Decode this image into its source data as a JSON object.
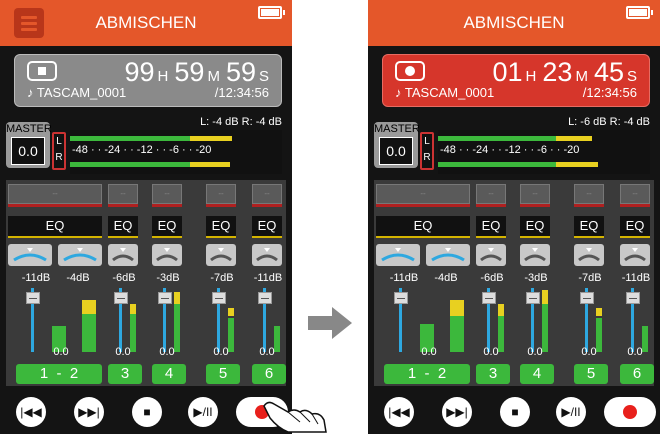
{
  "panels": [
    {
      "state": "stopped",
      "title": "ABMISCHEN",
      "counter": {
        "h": "99",
        "m": "59",
        "s": "59",
        "h_unit": "H",
        "m_unit": "M",
        "s_unit": "S",
        "file": "♪ TASCAM_0001",
        "total": "/12:34:56"
      },
      "master": {
        "label": "MASTER",
        "value": "0.0"
      },
      "meter": {
        "levels_text": "L:  -4 dB  R:  -4 dB",
        "scale": "-48 · · -24 · · -12 · · -6 · · -20",
        "lr": [
          "L",
          "R"
        ]
      },
      "channels": [
        {
          "gain": "-11dB",
          "gain2": "-4dB",
          "value": "0.0",
          "label": "1  -  2"
        },
        {
          "gain": "-6dB",
          "value": "0.0",
          "label": "3"
        },
        {
          "gain": "-3dB",
          "value": "0.0",
          "label": "4"
        },
        {
          "gain": "-7dB",
          "value": "0.0",
          "label": "5"
        },
        {
          "gain": "-11dB",
          "value": "0.0",
          "label": "6"
        }
      ],
      "eq_label": "EQ",
      "slot_text": "--"
    },
    {
      "state": "recording",
      "title": "ABMISCHEN",
      "counter": {
        "h": "01",
        "m": "23",
        "s": "45",
        "h_unit": "H",
        "m_unit": "M",
        "s_unit": "S",
        "file": "♪ TASCAM_0001",
        "total": "/12:34:56"
      },
      "master": {
        "label": "MASTER",
        "value": "0.0"
      },
      "meter": {
        "levels_text": "L:  -6 dB  R:  -4 dB",
        "scale": "-48 · · -24 · · -12 · · -6 · · -20",
        "lr": [
          "L",
          "R"
        ]
      },
      "channels": [
        {
          "gain": "-11dB",
          "gain2": "-4dB",
          "value": "0.0",
          "label": "1  -  2"
        },
        {
          "gain": "-6dB",
          "value": "0.0",
          "label": "3"
        },
        {
          "gain": "-3dB",
          "value": "0.0",
          "label": "4"
        },
        {
          "gain": "-7dB",
          "value": "0.0",
          "label": "5"
        },
        {
          "gain": "-11dB",
          "value": "0.0",
          "label": "6"
        }
      ],
      "eq_label": "EQ",
      "slot_text": "--"
    }
  ],
  "transport": {
    "rewind": "|◀◀",
    "forward": "▶▶|",
    "stop": "■",
    "playpause": "▶/II"
  },
  "colors": {
    "accent": "#e4572a",
    "record_red": "#d6362b",
    "channel_green": "#3cb83c",
    "eq_yellow": "#d4b400",
    "fader_blue": "#2ea8e0"
  }
}
